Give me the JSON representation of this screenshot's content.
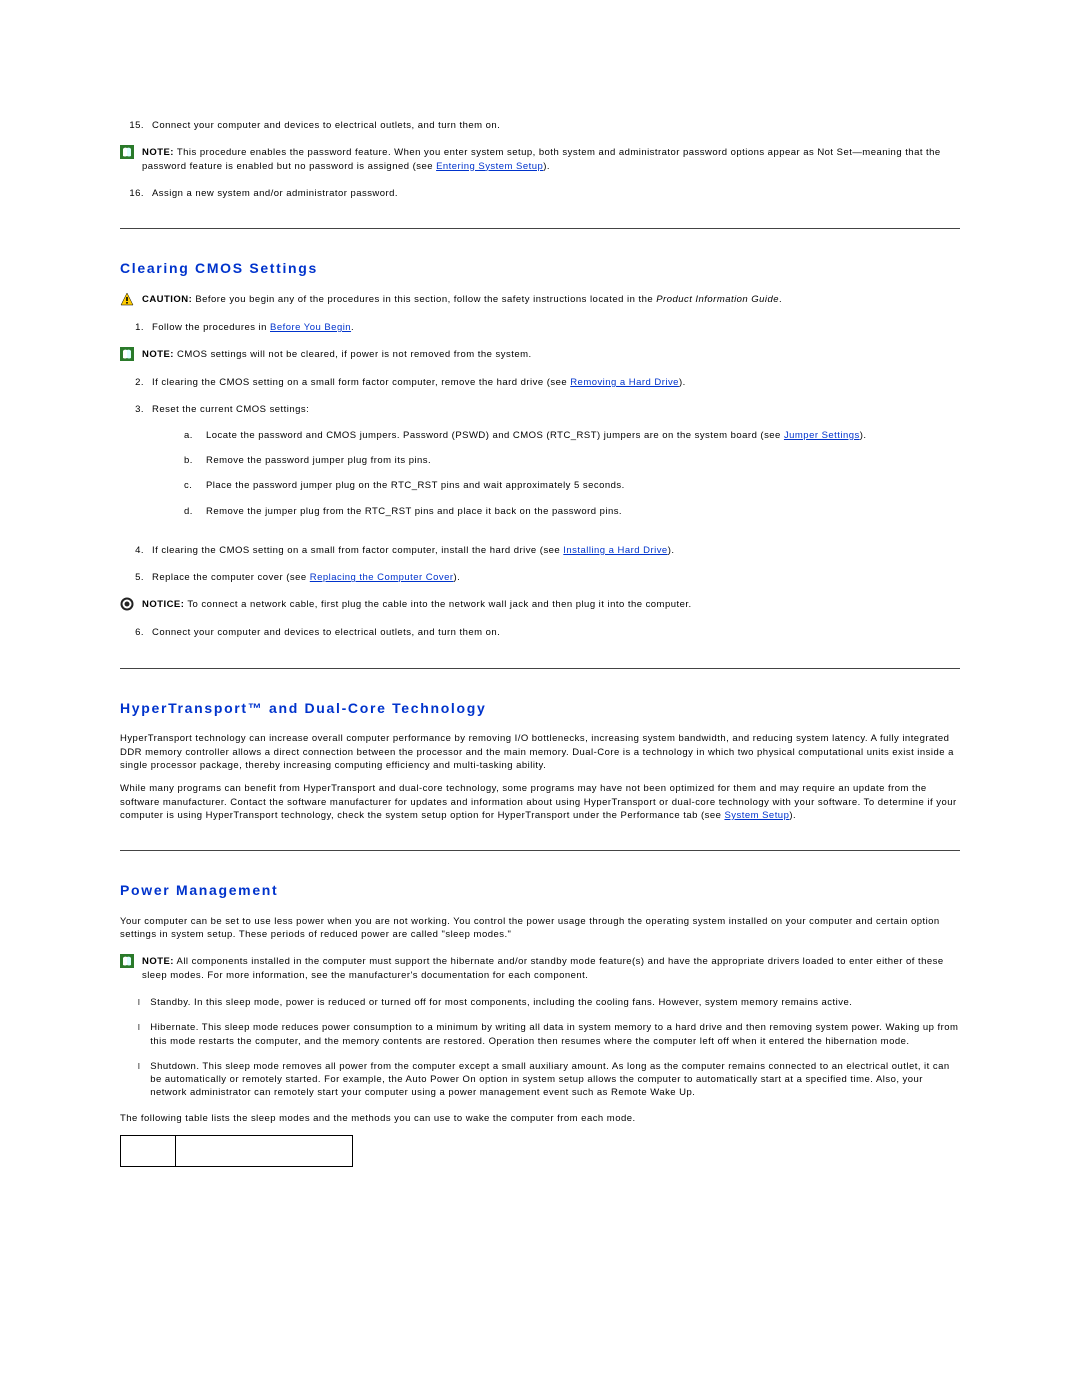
{
  "top_steps": {
    "num15": "15.",
    "text15": "Connect your computer and devices to electrical outlets, and turn them on.",
    "note_label": "NOTE:",
    "note_text_a": " This procedure enables the password feature. When you enter system setup, both system and administrator password options appear as Not Set—meaning that the password feature is enabled but no password is assigned (see ",
    "note_link": "Entering System Setup",
    "note_text_b": ").",
    "num16": "16.",
    "text16": "Assign a new system and/or administrator password."
  },
  "h1": "Clearing CMOS Settings",
  "caution": {
    "label": "CAUTION:",
    "text_a": " Before you begin any of the procedures in this section, follow the safety instructions located in the ",
    "italic": "Product Information Guide",
    "text_b": "."
  },
  "s1": {
    "num1": "1.",
    "text1a": "Follow the procedures in ",
    "link1": "Before You Begin",
    "text1b": ".",
    "note_label": "NOTE:",
    "note_text": " CMOS settings will not be cleared, if power is not removed from the system.",
    "num2": "2.",
    "text2a": "If clearing the CMOS setting on a small form factor computer, remove the hard drive (see ",
    "link2": "Removing a Hard Drive",
    "text2b": ").",
    "num3": "3.",
    "text3": "Reset the current CMOS settings:",
    "sub": {
      "al": "a.",
      "a_a": "Locate the password and CMOS jumpers. Password (PSWD) and CMOS (RTC_RST) jumpers are on the system board (see ",
      "a_link": "Jumper Settings",
      "a_b": ").",
      "bl": "b.",
      "b": "Remove the password jumper plug from its pins.",
      "cl": "c.",
      "c": "Place the password jumper plug on the RTC_RST pins and wait approximately 5 seconds.",
      "dl": "d.",
      "d": "Remove the jumper plug from the RTC_RST pins and place it back on the password pins."
    },
    "num4": "4.",
    "text4a": "If clearing the CMOS setting on a small from factor computer, install the hard drive (see ",
    "link4": "Installing a Hard Drive",
    "text4b": ").",
    "num5": "5.",
    "text5a": "Replace the computer cover (see ",
    "link5": "Replacing the Computer Cover",
    "text5b": ").",
    "notice_label": "NOTICE:",
    "notice_text": " To connect a network cable, first plug the cable into the network wall jack and then plug it into the computer.",
    "num6": "6.",
    "text6": "Connect your computer and devices to electrical outlets, and turn them on."
  },
  "h2": {
    "bold": "HyperTransport™ and Dual",
    "rest": "-Core Technology"
  },
  "ht": {
    "p1": "HyperTransport technology can increase overall computer performance by removing I/O bottlenecks, increasing system bandwidth, and reducing system latency. A fully integrated DDR memory controller allows a direct connection between the processor and the main memory. Dual-Core is a technology in which two physical computational units exist inside a single processor package, thereby increasing computing efficiency and multi-tasking ability.",
    "p2a": "While many programs can benefit from HyperTransport and dual-core technology, some programs may have not been optimized for them and may require an update from the software manufacturer. Contact the software manufacturer for updates and information about using HyperTransport or dual-core technology with your software. To determine if your computer is using HyperTransport technology, check the system setup option for HyperTransport under the Performance tab (see ",
    "p2link": "System Setup",
    "p2b": ")."
  },
  "h3": "Power Management",
  "pm": {
    "p1": "Your computer can be set to use less power when you are not working. You control the power usage through the operating system installed on your computer and certain option settings in system setup. These periods of reduced power are called \"sleep modes.\"",
    "note_label": "NOTE:",
    "note_text": " All components installed in the computer must support the hibernate and/or standby mode feature(s) and have the appropriate drivers loaded to enter either of these sleep modes. For more information, see the manufacturer's documentation for each component.",
    "b1": "Standby. In this sleep mode, power is reduced or turned off for most components, including the cooling fans. However, system memory remains active.",
    "b2": "Hibernate. This sleep mode reduces power consumption to a minimum by writing all data in system memory to a hard drive and then removing system power. Waking up from this mode restarts the computer, and the memory contents are restored. Operation then resumes where the computer left off when it entered the hibernation mode.",
    "b3": "Shutdown. This sleep mode removes all power from the computer except a small auxiliary amount. As long as the computer remains connected to an electrical outlet, it can be automatically or remotely started. For example, the Auto Power On option in system setup allows the computer to automatically start at a specified time. Also, your network administrator can remotely start your computer using a power management event such as Remote Wake Up.",
    "p2": "The following table lists the sleep modes and the methods you can use to wake the computer from each mode."
  }
}
